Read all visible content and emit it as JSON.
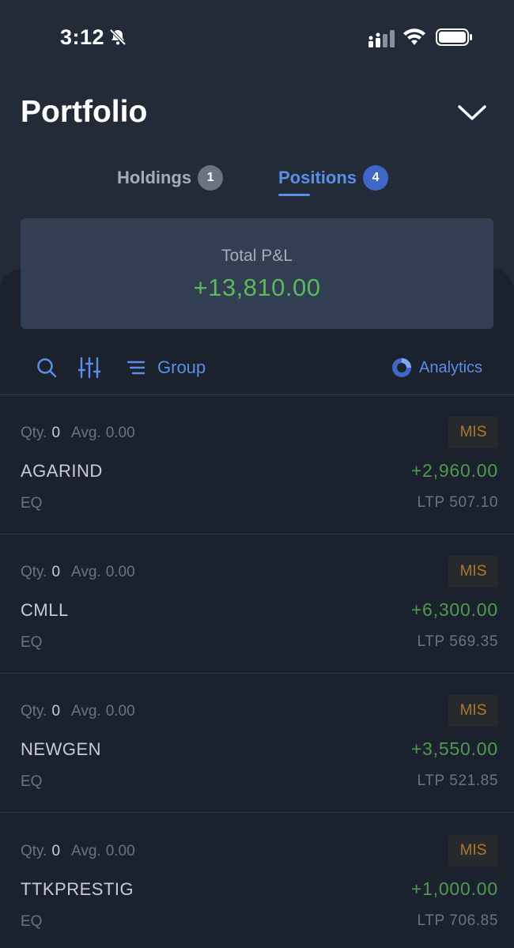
{
  "status_bar": {
    "time": "3:12"
  },
  "header": {
    "title": "Portfolio"
  },
  "tabs": [
    {
      "label": "Holdings",
      "count": "1",
      "active": false
    },
    {
      "label": "Positions",
      "count": "4",
      "active": true
    }
  ],
  "summary": {
    "label": "Total P&L",
    "value": "+13,810.00"
  },
  "toolbar": {
    "group_label": "Group",
    "analytics_label": "Analytics"
  },
  "positions": [
    {
      "qty_label": "Qty.",
      "qty": "0",
      "avg_label": "Avg.",
      "avg": "0.00",
      "product": "MIS",
      "symbol": "AGARIND",
      "pnl": "+2,960.00",
      "exchange": "EQ",
      "ltp": "LTP 507.10"
    },
    {
      "qty_label": "Qty.",
      "qty": "0",
      "avg_label": "Avg.",
      "avg": "0.00",
      "product": "MIS",
      "symbol": "CMLL",
      "pnl": "+6,300.00",
      "exchange": "EQ",
      "ltp": "LTP 569.35"
    },
    {
      "qty_label": "Qty.",
      "qty": "0",
      "avg_label": "Avg.",
      "avg": "0.00",
      "product": "MIS",
      "symbol": "NEWGEN",
      "pnl": "+3,550.00",
      "exchange": "EQ",
      "ltp": "LTP 521.85"
    },
    {
      "qty_label": "Qty.",
      "qty": "0",
      "avg_label": "Avg.",
      "avg": "0.00",
      "product": "MIS",
      "symbol": "TTKPRESTIG",
      "pnl": "+1,000.00",
      "exchange": "EQ",
      "ltp": "LTP 706.85"
    }
  ],
  "colors": {
    "accent": "#5b8ee6",
    "profit": "#5cb85c",
    "product_badge": "#b0772e",
    "background": "#1b212d"
  },
  "icons": [
    "bell-muted-icon",
    "signal-icon",
    "wifi-icon",
    "battery-icon",
    "chevron-down-icon",
    "search-icon",
    "filter-sliders-icon",
    "group-lines-icon",
    "analytics-ring-icon"
  ]
}
